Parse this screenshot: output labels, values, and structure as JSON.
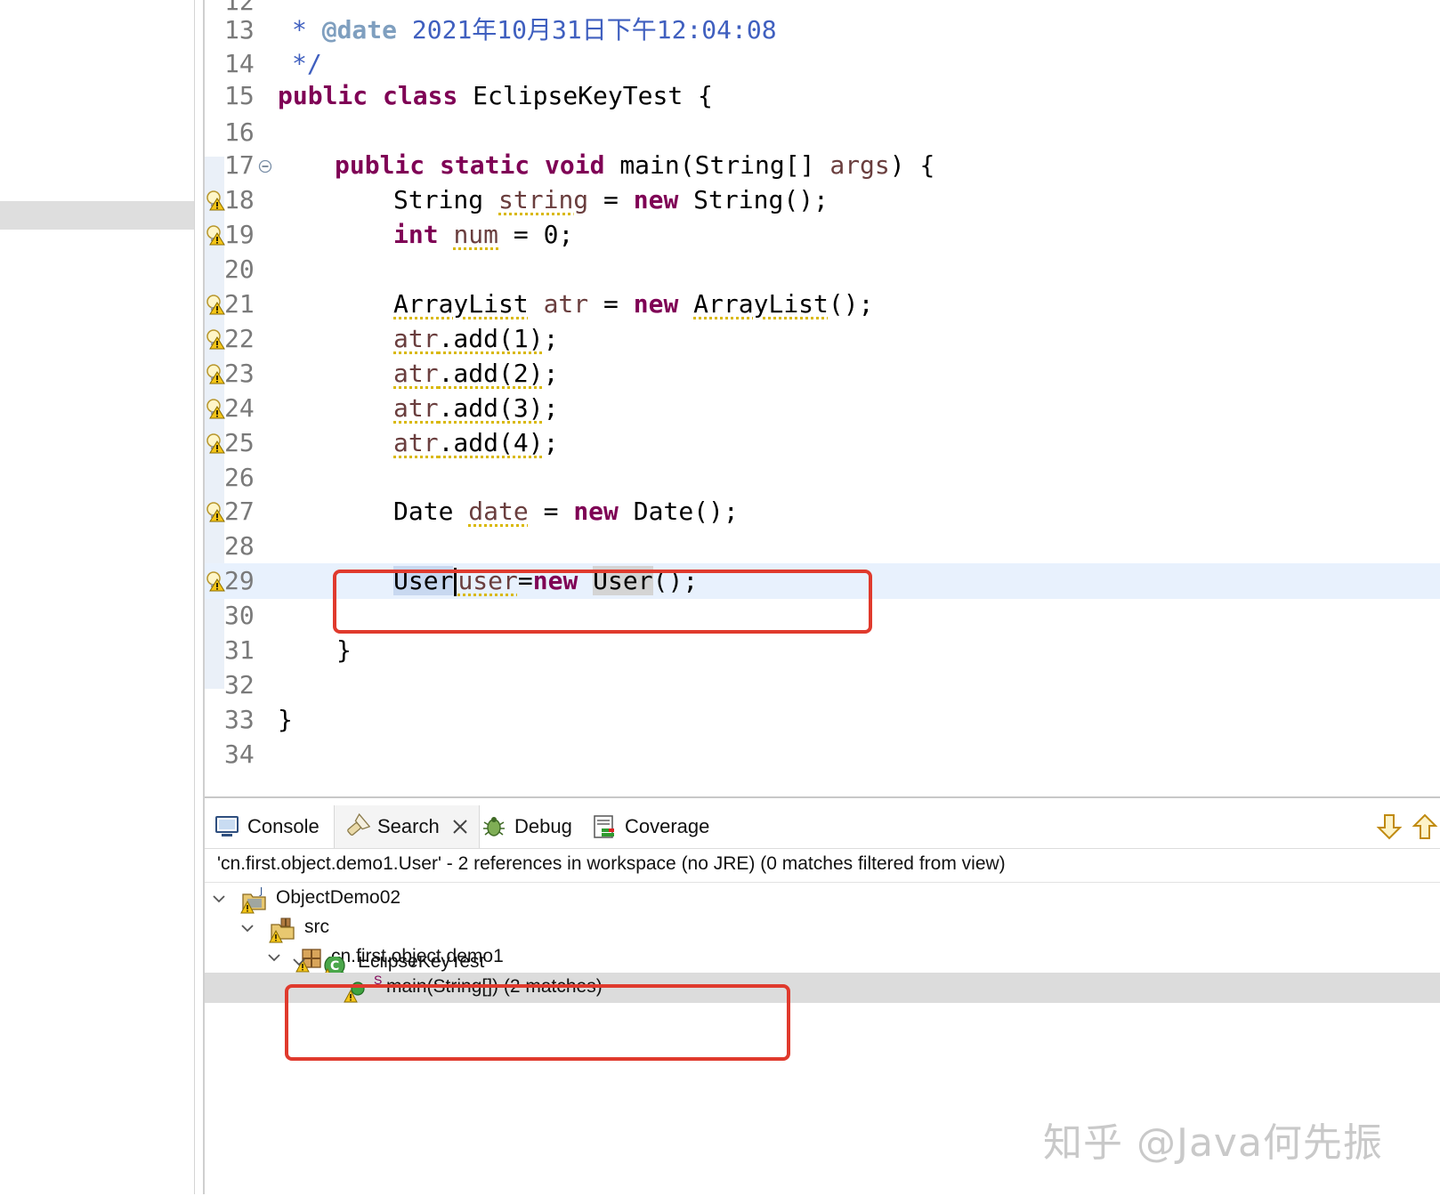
{
  "editor": {
    "lines": {
      "l13": {
        "n": "13",
        "star": "* ",
        "tag": "@date",
        "text": " 2021年10月31日下午12:04:08"
      },
      "l14": {
        "n": "14",
        "text": "*/"
      },
      "l15": {
        "n": "15",
        "kw1": "public",
        "kw2": "class",
        "rest": " EclipseKeyTest {"
      },
      "l16": {
        "n": "16"
      },
      "l17": {
        "n": "17",
        "kw1": "public",
        "kw2": "static",
        "kw3": "void",
        "rest": " main(String[] ",
        "param": "args",
        "end": ") {"
      },
      "l18": {
        "n": "18",
        "type": "String ",
        "var": "string",
        "mid": " = ",
        "kw": "new",
        "rest": " String();"
      },
      "l19": {
        "n": "19",
        "kw": "int",
        "var": "num",
        "rest": " = 0;"
      },
      "l20": {
        "n": "20"
      },
      "l21": {
        "n": "21",
        "type": "ArrayList",
        "var": " atr",
        "mid": " = ",
        "kw": "new",
        "type2": "ArrayList",
        "rest": "();"
      },
      "l22": {
        "n": "22",
        "obj": "atr",
        "call": ".add(1)",
        "end": ";"
      },
      "l23": {
        "n": "23",
        "obj": "atr",
        "call": ".add(2)",
        "end": ";"
      },
      "l24": {
        "n": "24",
        "obj": "atr",
        "call": ".add(3)",
        "end": ";"
      },
      "l25": {
        "n": "25",
        "obj": "atr",
        "call": ".add(4)",
        "end": ";"
      },
      "l26": {
        "n": "26"
      },
      "l27": {
        "n": "27",
        "type": "Date ",
        "var": "date",
        "mid": " = ",
        "kw": "new",
        "rest": " Date();"
      },
      "l28": {
        "n": "28"
      },
      "l29": {
        "n": "29",
        "type": "User",
        "var": "user",
        "eq": "=",
        "kw": "new",
        "type2": "User",
        "rest": "();"
      },
      "l30": {
        "n": "30"
      },
      "l31": {
        "n": "31",
        "text": "}"
      },
      "l32": {
        "n": "32"
      },
      "l33": {
        "n": "33",
        "text": "}"
      },
      "l34": {
        "n": "34"
      }
    }
  },
  "panel": {
    "tabs": {
      "console": "Console",
      "search": "Search",
      "debug": "Debug",
      "coverage": "Coverage"
    },
    "summary": "'cn.first.object.demo1.User' - 2 references in workspace (no JRE) (0 matches filtered from view)",
    "tree": {
      "project": "ObjectDemo02",
      "src": "src",
      "package": "cn.first.object.demo1",
      "class": "EclipseKeyTest",
      "method_static_mark": "S",
      "method": "main(String[]) (2 matches)"
    }
  },
  "watermark": "知乎 @Java何先振",
  "colors": {
    "keyword": "#7f0055",
    "javadoc": "#3f5fbf",
    "highlight_box": "#e03a2d",
    "current_line": "#e8f1fd"
  }
}
